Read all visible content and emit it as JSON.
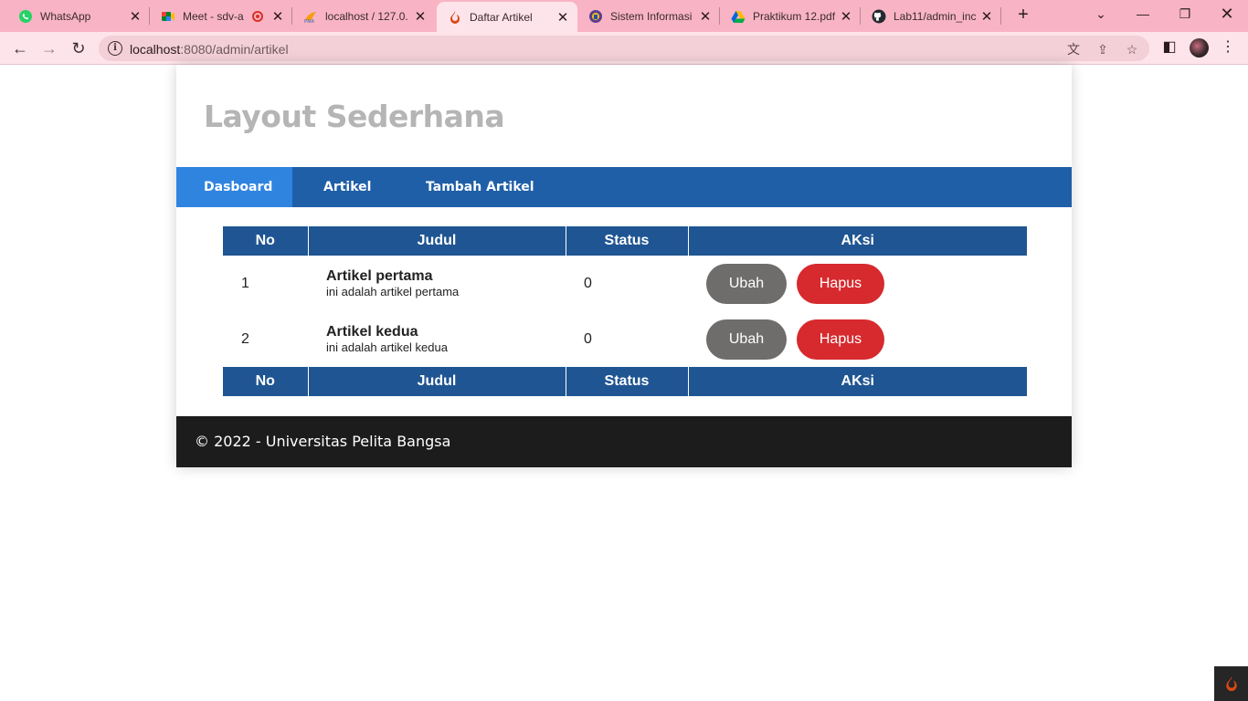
{
  "browser": {
    "tabs": [
      {
        "title": "WhatsApp",
        "icon": "whatsapp-icon"
      },
      {
        "title": "Meet - sdv-a",
        "icon": "meet-icon"
      },
      {
        "title": "localhost / 127.0.",
        "icon": "phpmyadmin-icon"
      },
      {
        "title": "Daftar Artikel",
        "icon": "codeigniter-icon"
      },
      {
        "title": "Sistem Informasi",
        "icon": "university-icon"
      },
      {
        "title": "Praktikum 12.pdf",
        "icon": "google-drive-icon"
      },
      {
        "title": "Lab11/admin_inc",
        "icon": "github-icon"
      }
    ],
    "url_host": "localhost",
    "url_rest": ":8080/admin/artikel"
  },
  "page": {
    "site_title": "Layout Sederhana",
    "nav": [
      {
        "label": "Dasboard",
        "active": true
      },
      {
        "label": "Artikel",
        "active": false
      },
      {
        "label": "Tambah Artikel",
        "active": false
      }
    ],
    "table": {
      "headers": [
        "No",
        "Judul",
        "Status",
        "AKsi"
      ],
      "rows": [
        {
          "no": "1",
          "title": "Artikel pertama",
          "desc": "ini adalah artikel pertama",
          "status": "0",
          "edit": "Ubah",
          "delete": "Hapus"
        },
        {
          "no": "2",
          "title": "Artikel kedua",
          "desc": "ini adalah artikel kedua",
          "status": "0",
          "edit": "Ubah",
          "delete": "Hapus"
        }
      ]
    },
    "footer": "© 2022 - Universitas Pelita Bangsa"
  },
  "colors": {
    "tab_bar": "#f8b4c4",
    "nav_bg": "#1f5fa8",
    "nav_active": "#2f84e0",
    "table_header": "#1f5592",
    "edit_button": "#6e6d6b",
    "delete_button": "#d62a2e",
    "footer_bg": "#1c1c1c"
  }
}
